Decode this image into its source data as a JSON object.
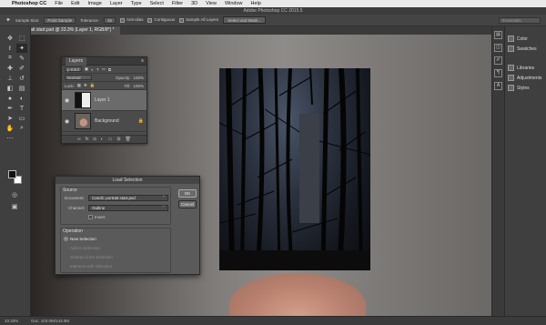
{
  "menubar": {
    "app": "Photoshop CC",
    "items": [
      "File",
      "Edit",
      "Image",
      "Layer",
      "Type",
      "Select",
      "Filter",
      "3D",
      "View",
      "Window",
      "Help"
    ]
  },
  "window_title": "Adobe Photoshop CC 2015.5",
  "options_bar": {
    "sample_size_label": "Sample Size:",
    "sample_size_value": "Point Sample",
    "tolerance_label": "Tolerance:",
    "tolerance_value": "15",
    "antialias_label": "Anti-alias",
    "contiguous_label": "Contiguous",
    "sample_all_layers_label": "Sample All Layers",
    "select_mask_label": "Select and Mask...",
    "search_placeholder": "Essentials"
  },
  "document_tab": "CandC portrait start.psd @ 33.3% (Layer 1, RGB/8*) *",
  "layers_panel": {
    "title": "Layers",
    "kind_label": "ρ Kind",
    "blend_mode": "Normal",
    "opacity_label": "Opacity:",
    "opacity_value": "100%",
    "lock_label": "Lock:",
    "fill_label": "Fill:",
    "fill_value": "100%",
    "layers": [
      {
        "name": "Layer 1"
      },
      {
        "name": "Background"
      }
    ]
  },
  "dock": {
    "items": [
      "Color",
      "Swatches",
      "Libraries",
      "Adjustments",
      "Styles"
    ]
  },
  "dialog": {
    "title": "Load Selection",
    "source_header": "Source",
    "document_label": "Document:",
    "document_value": "CandC portrait start.psd",
    "channel_label": "Channel:",
    "channel_value": "Outline",
    "invert_label": "Invert",
    "operation_header": "Operation",
    "operations": [
      "New Selection",
      "Add to Selection",
      "Subtract from Selection",
      "Intersect with Selection"
    ],
    "ok_label": "OK",
    "cancel_label": "Cancel"
  },
  "status_bar": {
    "zoom": "33.33%",
    "doc_info": "Doc: 103.0M/143.0M"
  },
  "colors": {
    "menubar": "#e9e9e9",
    "panel": "#4b4b4b",
    "canvas_bg": "#535353",
    "foreground": "#111111",
    "background": "#ffffff"
  }
}
